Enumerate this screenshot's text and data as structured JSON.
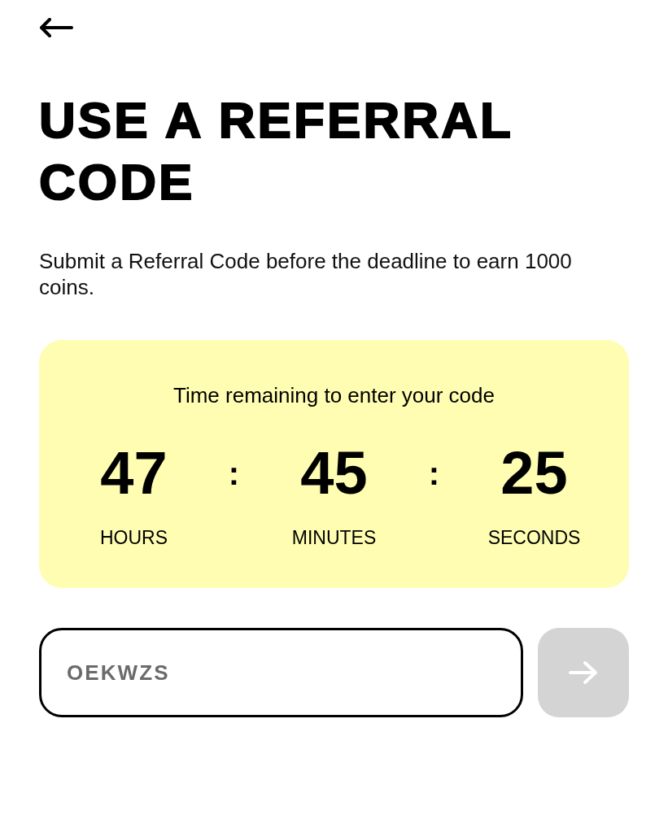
{
  "header": {
    "title": "USE A REFERRAL CODE",
    "description": "Submit a Referral Code before the deadline to earn 1000 coins."
  },
  "countdown": {
    "title": "Time remaining to enter your code",
    "units": [
      {
        "value": "47",
        "label": "HOURS"
      },
      {
        "value": "45",
        "label": "MINUTES"
      },
      {
        "value": "25",
        "label": "SECONDS"
      }
    ],
    "separators": [
      ":",
      ":"
    ]
  },
  "code_field": {
    "placeholder": "OEKWZS"
  },
  "submit_button": {
    "disabled": true
  }
}
